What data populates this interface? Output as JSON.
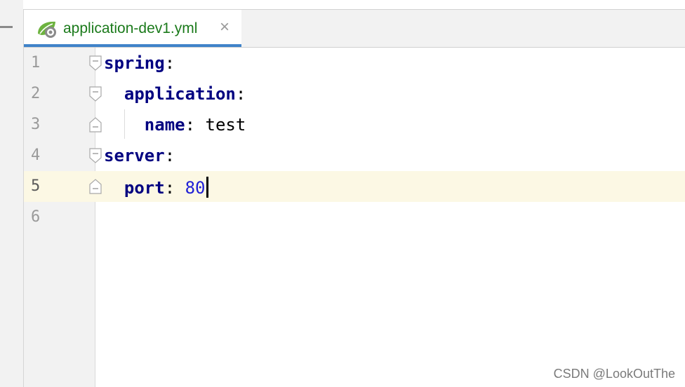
{
  "tab": {
    "filename": "application-dev1.yml",
    "close_glyph": "×",
    "icon": "spring-yaml-icon",
    "icon_color": "#6db33f"
  },
  "editor": {
    "lines": [
      {
        "number": "1",
        "indent": "",
        "key": "spring",
        "colon": ":",
        "value": "",
        "value_type": "none",
        "fold": "open"
      },
      {
        "number": "2",
        "indent": "  ",
        "key": "application",
        "colon": ":",
        "value": "",
        "value_type": "none",
        "fold": "open"
      },
      {
        "number": "3",
        "indent": "    ",
        "key": "name",
        "colon": ":",
        "value": " test",
        "value_type": "string",
        "fold": "close"
      },
      {
        "number": "4",
        "indent": "",
        "key": "server",
        "colon": ":",
        "value": "",
        "value_type": "none",
        "fold": "open"
      },
      {
        "number": "5",
        "indent": "  ",
        "key": "port",
        "colon": ":",
        "value": " 80",
        "value_type": "number",
        "fold": "close",
        "current": true
      },
      {
        "number": "6",
        "indent": "",
        "key": "",
        "colon": "",
        "value": "",
        "value_type": "none",
        "fold": "none"
      }
    ],
    "key_color": "#000080",
    "number_color": "#1f1fd6",
    "current_line_color": "#fcf8e4"
  },
  "watermark": "CSDN @LookOutThe"
}
